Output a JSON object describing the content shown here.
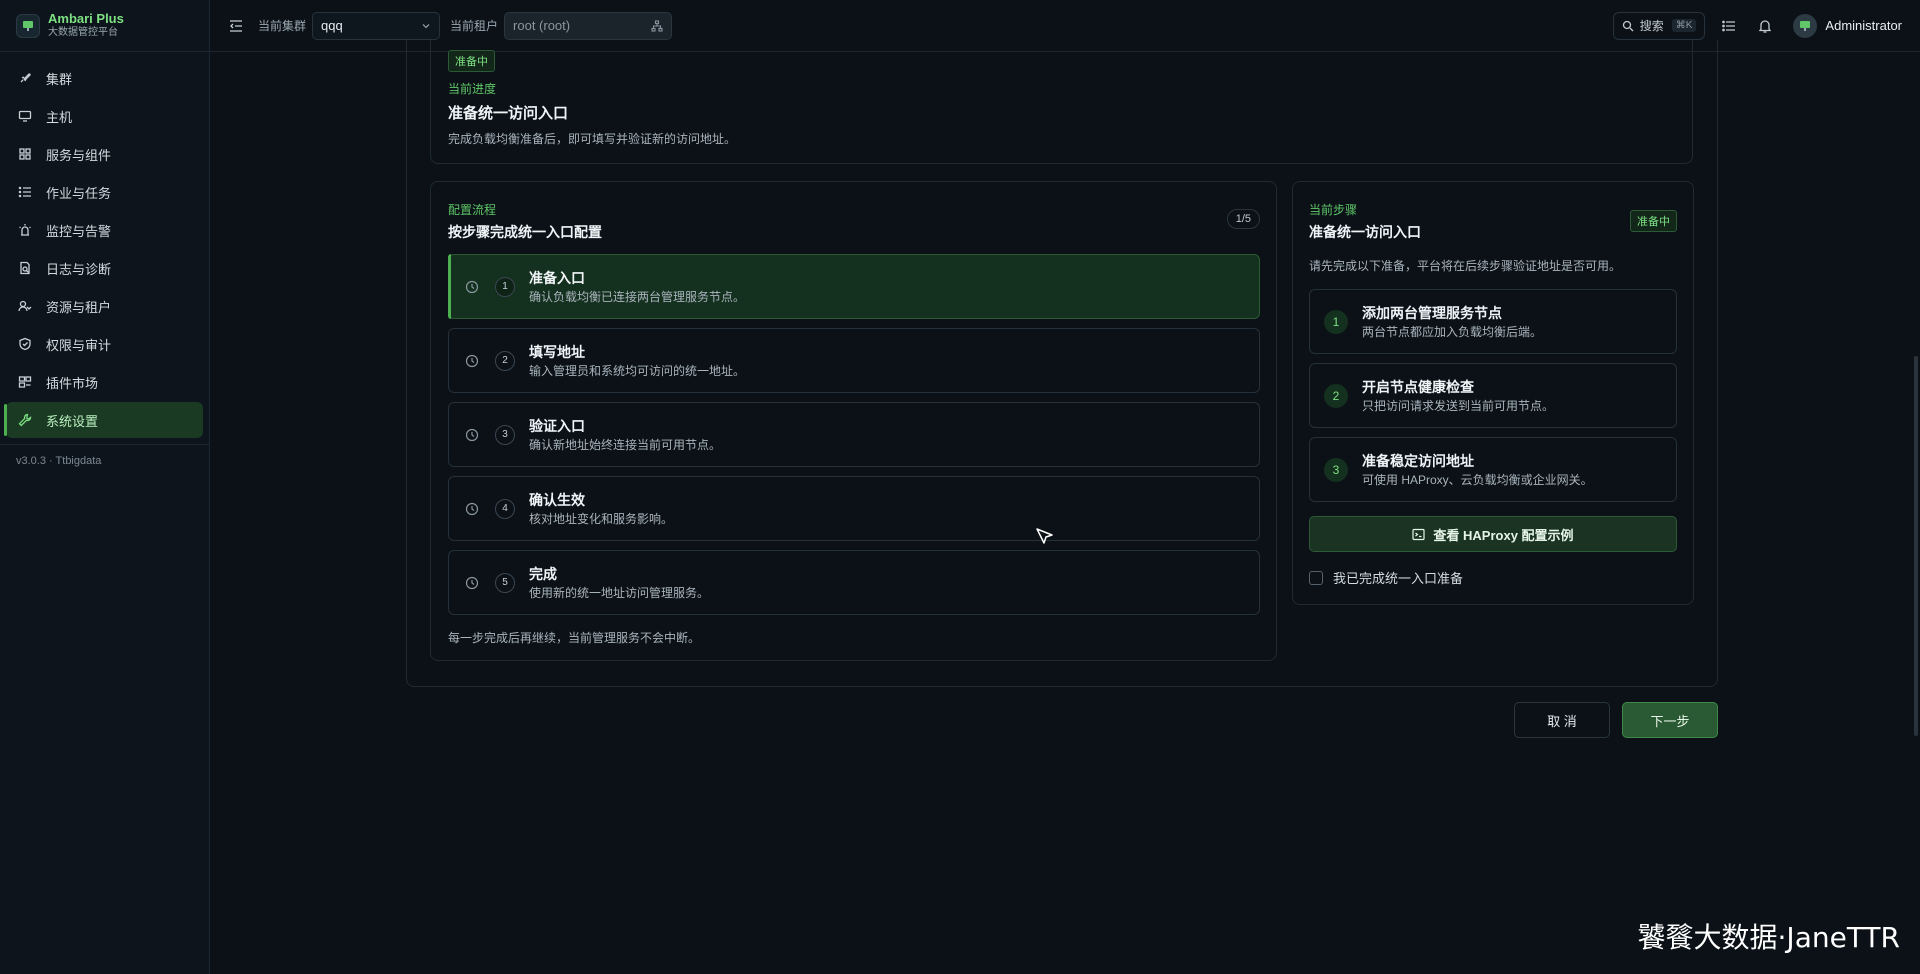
{
  "brand": {
    "title": "Ambari Plus",
    "subtitle": "大数据管控平台"
  },
  "sidebar": {
    "items": [
      {
        "label": "集群",
        "icon": "rocket-icon"
      },
      {
        "label": "主机",
        "icon": "monitor-icon"
      },
      {
        "label": "服务与组件",
        "icon": "grid-icon"
      },
      {
        "label": "作业与任务",
        "icon": "list-icon"
      },
      {
        "label": "监控与告警",
        "icon": "alarm-icon"
      },
      {
        "label": "日志与诊断",
        "icon": "log-icon"
      },
      {
        "label": "资源与租户",
        "icon": "users-icon"
      },
      {
        "label": "权限与审计",
        "icon": "shield-icon"
      },
      {
        "label": "插件市场",
        "icon": "plugin-icon"
      },
      {
        "label": "系统设置",
        "icon": "wrench-icon"
      }
    ],
    "active_index": 9,
    "version": "v3.0.3 · Ttbigdata"
  },
  "topbar": {
    "cluster_label": "当前集群",
    "cluster_value": "qqq",
    "tenant_label": "当前租户",
    "tenant_value": "root (root)",
    "search_label": "搜索",
    "search_shortcut": "⌘K",
    "user": "Administrator"
  },
  "progress": {
    "badge": "准备中",
    "label": "当前进度",
    "title": "准备统一访问入口",
    "desc": "完成负载均衡准备后，即可填写并验证新的访问地址。"
  },
  "flow": {
    "label": "配置流程",
    "title": "按步骤完成统一入口配置",
    "counter": "1/5",
    "steps": [
      {
        "num": "1",
        "title": "准备入口",
        "desc": "确认负载均衡已连接两台管理服务节点。"
      },
      {
        "num": "2",
        "title": "填写地址",
        "desc": "输入管理员和系统均可访问的统一地址。"
      },
      {
        "num": "3",
        "title": "验证入口",
        "desc": "确认新地址始终连接当前可用节点。"
      },
      {
        "num": "4",
        "title": "确认生效",
        "desc": "核对地址变化和服务影响。"
      },
      {
        "num": "5",
        "title": "完成",
        "desc": "使用新的统一地址访问管理服务。"
      }
    ],
    "footer": "每一步完成后再继续，当前管理服务不会中断。"
  },
  "current_step": {
    "label": "当前步骤",
    "title": "准备统一访问入口",
    "badge": "准备中",
    "intro": "请先完成以下准备，平台将在后续步骤验证地址是否可用。",
    "items": [
      {
        "num": "1",
        "title": "添加两台管理服务节点",
        "desc": "两台节点都应加入负载均衡后端。"
      },
      {
        "num": "2",
        "title": "开启节点健康检查",
        "desc": "只把访问请求发送到当前可用节点。"
      },
      {
        "num": "3",
        "title": "准备稳定访问地址",
        "desc": "可使用 HAProxy、云负载均衡或企业网关。"
      }
    ],
    "haproxy_button": "查看 HAProxy 配置示例",
    "checkbox_label": "我已完成统一入口准备"
  },
  "actions": {
    "cancel": "取 消",
    "next": "下一步"
  },
  "watermark": "饕餮大数据·JaneTTR"
}
